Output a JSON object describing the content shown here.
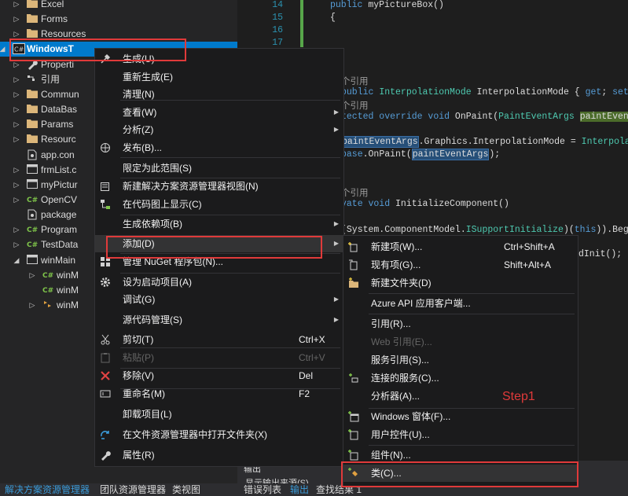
{
  "solution_explorer": {
    "items": [
      {
        "label": "Excel",
        "icon": "folder-icon",
        "expand": "collapsed"
      },
      {
        "label": "Forms",
        "icon": "folder-icon",
        "expand": "collapsed"
      },
      {
        "label": "Resources",
        "icon": "folder-icon",
        "expand": "collapsed"
      },
      {
        "label": "WindowsT",
        "icon": "csharp-project-icon",
        "expand": "expanded",
        "selected": true
      },
      {
        "label": "Properti",
        "icon": "wrench-icon",
        "expand": "collapsed"
      },
      {
        "label": "引用",
        "icon": "references-icon",
        "expand": "collapsed"
      },
      {
        "label": "Commun",
        "icon": "folder-icon",
        "expand": "collapsed"
      },
      {
        "label": "DataBas",
        "icon": "folder-icon",
        "expand": "collapsed"
      },
      {
        "label": "Params",
        "icon": "folder-icon",
        "expand": "collapsed"
      },
      {
        "label": "Resourc",
        "icon": "folder-icon",
        "expand": "collapsed"
      },
      {
        "label": "app.con",
        "icon": "config-file-icon",
        "expand": "none"
      },
      {
        "label": "frmList.c",
        "icon": "form-file-icon",
        "expand": "collapsed"
      },
      {
        "label": "myPictur",
        "icon": "form-file-icon",
        "expand": "collapsed"
      },
      {
        "label": "OpenCV",
        "icon": "csharp-file-icon",
        "expand": "collapsed"
      },
      {
        "label": "package",
        "icon": "config-file-icon",
        "expand": "none"
      },
      {
        "label": "Program",
        "icon": "csharp-file-icon",
        "expand": "collapsed"
      },
      {
        "label": "TestData",
        "icon": "csharp-file-icon",
        "expand": "collapsed"
      },
      {
        "label": "winMain",
        "icon": "form-file-icon",
        "expand": "expanded"
      },
      {
        "label": "winM",
        "icon": "csharp-file-icon",
        "expand": "collapsed"
      },
      {
        "label": "winM",
        "icon": "csharp-file-icon",
        "expand": "none"
      },
      {
        "label": "winM",
        "icon": "resx-icon",
        "expand": "collapsed"
      }
    ],
    "bottom_tabs": [
      "解决方案资源管理器",
      "团队资源管理器",
      "类视图"
    ]
  },
  "editor": {
    "line_numbers": [
      "14",
      "15",
      "16",
      "17"
    ],
    "code_lines": [
      "public myPictureBox()",
      "{",
      "个引用",
      "public InterpolationMode InterpolationMode { get; set; }",
      "个引用",
      "tected override void OnPaint(PaintEventArgs paintEventArgs)",
      "paintEventArgs.Graphics.InterpolationMode = InterpolationMode.N",
      "base.OnPaint(paintEventArgs);",
      "个引用",
      "vate void InitializeComponent()",
      "(System.ComponentModel.ISupportInitialize)(this)).BeginInit();",
      "dInit();"
    ],
    "output_tabs": [
      "错误列表",
      "输出",
      "查找结果 1"
    ],
    "output_title": "输出",
    "output_source": "显示输出来源(S)"
  },
  "context_menu": {
    "items": [
      {
        "label": "生成(U)",
        "icon": "build-icon"
      },
      {
        "label": "重新生成(E)",
        "icon": ""
      },
      {
        "label": "清理(N)",
        "icon": ""
      },
      {
        "label": "查看(W)",
        "icon": "",
        "submenu": true
      },
      {
        "label": "分析(Z)",
        "icon": "",
        "submenu": true
      },
      {
        "label": "发布(B)...",
        "icon": "globe-icon"
      },
      {
        "label": "限定为此范围(S)",
        "icon": ""
      },
      {
        "label": "新建解决方案资源管理器视图(N)",
        "icon": "new-view-icon"
      },
      {
        "label": "在代码图上显示(C)",
        "icon": "code-map-icon"
      },
      {
        "label": "生成依赖项(B)",
        "icon": "",
        "submenu": true
      },
      {
        "label": "添加(D)",
        "icon": "",
        "submenu": true
      },
      {
        "label": "管理 NuGet 程序包(N)...",
        "icon": "nuget-icon"
      },
      {
        "label": "设为启动项目(A)",
        "icon": "gear-icon"
      },
      {
        "label": "调试(G)",
        "icon": "",
        "submenu": true
      },
      {
        "label": "源代码管理(S)",
        "icon": "",
        "submenu": true
      },
      {
        "label": "剪切(T)",
        "icon": "scissors-icon",
        "key": "Ctrl+X"
      },
      {
        "label": "粘贴(P)",
        "icon": "paste-icon",
        "key": "Ctrl+V",
        "disabled": true
      },
      {
        "label": "移除(V)",
        "icon": "remove-icon",
        "key": "Del"
      },
      {
        "label": "重命名(M)",
        "icon": "rename-icon",
        "key": "F2"
      },
      {
        "label": "卸载项目(L)",
        "icon": ""
      },
      {
        "label": "在文件资源管理器中打开文件夹(X)",
        "icon": "refresh-arrow-icon"
      },
      {
        "label": "属性(R)",
        "icon": "wrench-icon"
      }
    ]
  },
  "add_submenu": {
    "items": [
      {
        "label": "新建项(W)...",
        "icon": "new-item-icon",
        "key": "Ctrl+Shift+A"
      },
      {
        "label": "现有项(G)...",
        "icon": "existing-item-icon",
        "key": "Shift+Alt+A"
      },
      {
        "label": "新建文件夹(D)",
        "icon": "new-folder-icon"
      },
      {
        "label": "Azure API 应用客户端...",
        "icon": ""
      },
      {
        "label": "引用(R)...",
        "icon": ""
      },
      {
        "label": "Web 引用(E)...",
        "icon": "",
        "disabled": true
      },
      {
        "label": "服务引用(S)...",
        "icon": ""
      },
      {
        "label": "连接的服务(C)...",
        "icon": "connected-service-icon"
      },
      {
        "label": "分析器(A)...",
        "icon": ""
      },
      {
        "label": "Windows 窗体(F)...",
        "icon": "add-form-icon"
      },
      {
        "label": "用户控件(U)...",
        "icon": "user-control-icon"
      },
      {
        "label": "组件(N)...",
        "icon": "component-icon"
      },
      {
        "label": "类(C)...",
        "icon": "add-class-icon"
      }
    ],
    "annotation": "Step1"
  },
  "colors": {
    "accent": "#007acc",
    "highlight_box": "#e03a3a",
    "menu_bg": "#1b1b1c"
  }
}
